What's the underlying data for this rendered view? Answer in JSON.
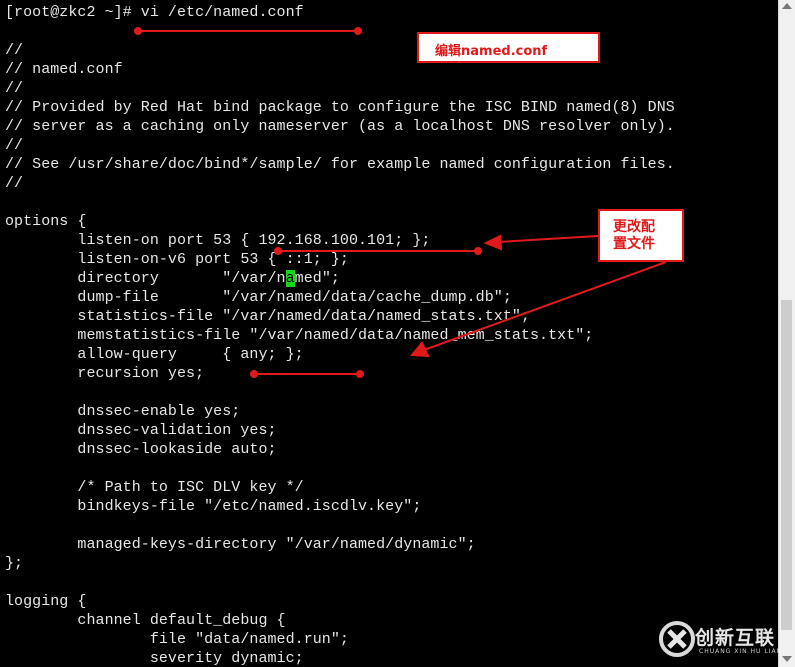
{
  "terminal": {
    "lines": [
      "[root@zkc2 ~]# vi /etc/named.conf",
      "",
      "//",
      "// named.conf",
      "//",
      "// Provided by Red Hat bind package to configure the ISC BIND named(8) DNS",
      "// server as a caching only nameserver (as a localhost DNS resolver only).",
      "//",
      "// See /usr/share/doc/bind*/sample/ for example named configuration files.",
      "//",
      "",
      "options {",
      "        listen-on port 53 { 192.168.100.101; };",
      "        listen-on-v6 port 53 { ::1; };",
      "        directory       \"/var/named\";",
      "        dump-file       \"/var/named/data/cache_dump.db\";",
      "        statistics-file \"/var/named/data/named_stats.txt\";",
      "        memstatistics-file \"/var/named/data/named_mem_stats.txt\";",
      "        allow-query     { any; };",
      "        recursion yes;",
      "",
      "        dnssec-enable yes;",
      "        dnssec-validation yes;",
      "        dnssec-lookaside auto;",
      "",
      "        /* Path to ISC DLV key */",
      "        bindkeys-file \"/etc/named.iscdlv.key\";",
      "",
      "        managed-keys-directory \"/var/named/dynamic\";",
      "};",
      "",
      "logging {",
      "        channel default_debug {",
      "                file \"data/named.run\";",
      "                severity dynamic;"
    ],
    "cursor": {
      "line": 14,
      "col": 31
    }
  },
  "annotations": {
    "edit_note": "编辑named.conf",
    "change_note_line1": "更改配",
    "change_note_line2": "置文件",
    "color": "#e01a1a"
  },
  "watermark": {
    "brand": "创新互联",
    "sub": "CHUANG XIN HU LIAN",
    "icon": "brand-logo-icon"
  }
}
